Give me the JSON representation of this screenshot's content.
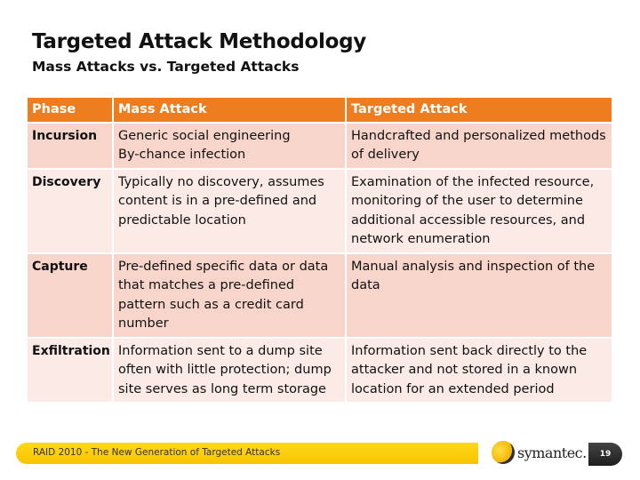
{
  "slide": {
    "title": "Targeted Attack Methodology",
    "subtitle": "Mass Attacks vs. Targeted Attacks"
  },
  "table": {
    "headers": [
      "Phase",
      "Mass Attack",
      "Targeted Attack"
    ],
    "rows": [
      {
        "phase": "Incursion",
        "mass": "Generic social engineering\nBy-chance infection",
        "targeted": "Handcrafted and personalized methods of delivery"
      },
      {
        "phase": "Discovery",
        "mass": "Typically no discovery, assumes content is in a pre-defined and predictable location",
        "targeted": "Examination of the infected resource, monitoring of the user to determine additional accessible resources, and network enumeration"
      },
      {
        "phase": "Capture",
        "mass": "Pre-defined specific data or data that matches a pre-defined pattern such as a credit card number",
        "targeted": "Manual analysis and inspection of the data"
      },
      {
        "phase": "Exfiltration",
        "mass": "Information sent to a dump site often with little protection; dump site serves as long term storage",
        "targeted": "Information sent back directly to the attacker and not stored in a known location for an extended period"
      }
    ]
  },
  "footer": {
    "text": "RAID 2010 - The New Generation of Targeted Attacks",
    "logo_text": "symantec.",
    "page_number": "19"
  },
  "colors": {
    "header": "#ed7d1f",
    "row_dark": "#f8d5cb",
    "row_light": "#fbeae6",
    "footer_bar": "#ffd200"
  }
}
